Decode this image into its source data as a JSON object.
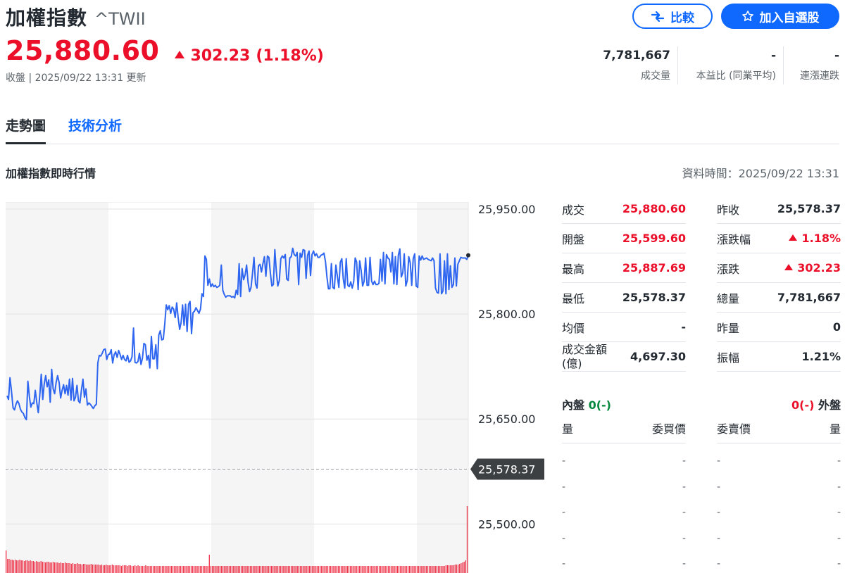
{
  "header": {
    "title": "加權指數",
    "ticker": "^TWII",
    "compare_label": "比較",
    "watchlist_label": "加入自選股",
    "price": "25,880.60",
    "change": "302.23",
    "change_pct": "(1.18%)",
    "status": "收盤 | 2025/09/22 13:31 更新"
  },
  "top_stats": [
    {
      "value": "7,781,667",
      "label": "成交量"
    },
    {
      "value": "-",
      "label": "本益比 (同業平均)"
    },
    {
      "value": "-",
      "label": "連漲連跌"
    }
  ],
  "tabs": [
    {
      "label": "走勢圖",
      "active": true
    },
    {
      "label": "技術分析",
      "active": false
    }
  ],
  "section": {
    "title": "加權指數即時行情",
    "data_time": "資料時間：2025/09/22 13:31"
  },
  "chart_data": {
    "type": "line",
    "y_ticks": [
      "25,950.00",
      "25,800.00",
      "25,650.00",
      "25,500.00"
    ],
    "y_tick_values": [
      25950,
      25800,
      25650,
      25500
    ],
    "prev_close": 25578.37,
    "prev_close_label": "25,578.37",
    "ylim": [
      25430,
      25960
    ],
    "series": [
      {
        "values": [
          25683,
          25678,
          25709,
          25690,
          25666,
          25663,
          25671,
          25676,
          25672,
          25664,
          25660,
          25658,
          25652,
          25649,
          25704,
          25682,
          25667,
          25673,
          25672,
          25691,
          25673,
          25659,
          25684,
          25714,
          25678,
          25700,
          25712,
          25696,
          25706,
          25674,
          25721,
          25693,
          25686,
          25702,
          25712,
          25702,
          25680,
          25691,
          25699,
          25686,
          25698,
          25684,
          25707,
          25677,
          25708,
          25676,
          25681,
          25698,
          25676,
          25673,
          25691,
          25707,
          25681,
          25693,
          25670,
          25673,
          25671,
          25668,
          25665,
          25669,
          25671,
          25730,
          25741,
          25740,
          25744,
          25749,
          25750,
          25735,
          25742,
          25743,
          25749,
          25730,
          25742,
          25746,
          25738,
          25748,
          25742,
          25735,
          25741,
          25735,
          25733,
          25741,
          25731,
          25733,
          25739,
          25780,
          25731,
          25730,
          25732,
          25744,
          25728,
          25737,
          25758,
          25756,
          25734,
          25741,
          25723,
          25768,
          25736,
          25736,
          25756,
          25722,
          25770,
          25776,
          25763,
          25764,
          25786,
          25813,
          25806,
          25812,
          25801,
          25810,
          25807,
          25795,
          25816,
          25795,
          25778,
          25788,
          25813,
          25784,
          25814,
          25775,
          25814,
          25818,
          25772,
          25802,
          25804,
          25809,
          25805,
          25801,
          25807,
          25829,
          25825,
          25883,
          25878,
          25841,
          25850,
          25839,
          25843,
          25839,
          25841,
          25838,
          25839,
          25841,
          25870,
          25834,
          25828,
          25824,
          25826,
          25826,
          25826,
          25824,
          25825,
          25823,
          25834,
          25828,
          25872,
          25825,
          25865,
          25849,
          25856,
          25870,
          25845,
          25832,
          25838,
          25858,
          25881,
          25843,
          25837,
          25869,
          25871,
          25860,
          25872,
          25882,
          25854,
          25883,
          25881,
          25858,
          25840,
          25842,
          25892,
          25861,
          25840,
          25848,
          25879,
          25883,
          25880,
          25885,
          25850,
          25848,
          25880,
          25882,
          25894,
          25885,
          25883,
          25888,
          25842,
          25887,
          25881,
          25892,
          25891,
          25851,
          25884,
          25890,
          25855,
          25885,
          25890,
          25883,
          25886,
          25881,
          25881,
          25884,
          25885,
          25887,
          25875,
          25853,
          25836,
          25836,
          25872,
          25838,
          25836,
          25870,
          25854,
          25838,
          25874,
          25879,
          25850,
          25837,
          25879,
          25841,
          25839,
          25846,
          25837,
          25846,
          25880,
          25874,
          25835,
          25876,
          25862,
          25840,
          25847,
          25880,
          25841,
          25841,
          25881,
          25847,
          25842,
          25847,
          25842,
          25842,
          25844,
          25878,
          25847,
          25888,
          25843,
          25885,
          25880,
          25878,
          25860,
          25888,
          25843,
          25882,
          25842,
          25884,
          25893,
          25853,
          25859,
          25886,
          25840,
          25848,
          25882,
          25873,
          25841,
          25879,
          25886,
          25840,
          25838,
          25883,
          25877,
          25883,
          25878,
          25879,
          25880,
          25878,
          25877,
          25876,
          25880,
          25876,
          25837,
          25831,
          25830,
          25886,
          25829,
          25833,
          25876,
          25829,
          25886,
          25835,
          25869,
          25838,
          25842,
          25880,
          25840,
          25871,
          25876,
          25881,
          25880,
          25880,
          25880,
          25878,
          25884
        ]
      }
    ],
    "volume": [
      32,
      20,
      20,
      19,
      19,
      18,
      19,
      18,
      18,
      19,
      18,
      18,
      17,
      18,
      18,
      17,
      18,
      17,
      17,
      16,
      17,
      16,
      16,
      17,
      16,
      16,
      15,
      16,
      16,
      15,
      15,
      16,
      15,
      15,
      15,
      14,
      15,
      14,
      14,
      15,
      14,
      14,
      14,
      13,
      14,
      13,
      13,
      14,
      13,
      13,
      12,
      13,
      13,
      12,
      12,
      12,
      13,
      12,
      12,
      12,
      12,
      12,
      11,
      12,
      11,
      11,
      12,
      11,
      11,
      11,
      12,
      11,
      11,
      11,
      11,
      11,
      10,
      11,
      11,
      11,
      10,
      11,
      11,
      10,
      10,
      11,
      10,
      11,
      10,
      10,
      10,
      10,
      11,
      10,
      10,
      10,
      10,
      10,
      10,
      10,
      10,
      10,
      10,
      10,
      10,
      10,
      10,
      10,
      10,
      10,
      10,
      10,
      10,
      10,
      10,
      10,
      10,
      10,
      10,
      10,
      10,
      10,
      10,
      10,
      10,
      10,
      10,
      10,
      10,
      10,
      10,
      10,
      10,
      10,
      26,
      10,
      10,
      10,
      10,
      10,
      10,
      10,
      10,
      10,
      10,
      10,
      10,
      10,
      10,
      10,
      10,
      10,
      10,
      10,
      10,
      10,
      10,
      10,
      10,
      10,
      10,
      10,
      10,
      10,
      10,
      10,
      10,
      10,
      10,
      10,
      10,
      10,
      10,
      10,
      10,
      10,
      10,
      10,
      10,
      10,
      10,
      10,
      10,
      10,
      10,
      10,
      10,
      10,
      10,
      10,
      10,
      10,
      10,
      10,
      10,
      10,
      10,
      10,
      10,
      10,
      10,
      10,
      10,
      10,
      10,
      10,
      10,
      10,
      10,
      10,
      10,
      10,
      10,
      10,
      10,
      10,
      10,
      10,
      10,
      10,
      10,
      10,
      10,
      10,
      10,
      10,
      10,
      10,
      10,
      10,
      10,
      10,
      10,
      10,
      10,
      10,
      10,
      10,
      10,
      10,
      10,
      10,
      10,
      10,
      10,
      10,
      10,
      10,
      10,
      10,
      10,
      10,
      10,
      10,
      10,
      10,
      10,
      10,
      10,
      10,
      10,
      10,
      10,
      10,
      10,
      10,
      10,
      10,
      10,
      10,
      10,
      10,
      10,
      10,
      10,
      10,
      10,
      10,
      10,
      10,
      10,
      10,
      10,
      10,
      10,
      10,
      10,
      10,
      10,
      10,
      11,
      11,
      11,
      11,
      11,
      11,
      12,
      12,
      12,
      13,
      14,
      15,
      16,
      18,
      95
    ]
  },
  "quote": [
    [
      {
        "label": "成交",
        "value": "25,880.60",
        "up": true
      },
      {
        "label": "昨收",
        "value": "25,578.37"
      }
    ],
    [
      {
        "label": "開盤",
        "value": "25,599.60",
        "up": true
      },
      {
        "label": "漲跌幅",
        "value": "1.18%",
        "up": true,
        "arrow": true
      }
    ],
    [
      {
        "label": "最高",
        "value": "25,887.69",
        "up": true
      },
      {
        "label": "漲跌",
        "value": "302.23",
        "up": true,
        "arrow": true
      }
    ],
    [
      {
        "label": "最低",
        "value": "25,578.37"
      },
      {
        "label": "總量",
        "value": "7,781,667"
      }
    ],
    [
      {
        "label": "均價",
        "value": "-"
      },
      {
        "label": "昨量",
        "value": "0"
      }
    ],
    [
      {
        "label": "成交金額\n(億)",
        "value": "4,697.30"
      },
      {
        "label": "振幅",
        "value": "1.21%"
      }
    ]
  ],
  "inner_outer": {
    "inner_label": "內盤",
    "inner_value": "0(-)",
    "outer_value": "0(-)",
    "outer_label": "外盤"
  },
  "order_book": {
    "headers": [
      "量",
      "委買價",
      "委賣價",
      "量"
    ],
    "rows": [
      [
        "-",
        "-",
        "-",
        "-"
      ],
      [
        "-",
        "-",
        "-",
        "-"
      ],
      [
        "-",
        "-",
        "-",
        "-"
      ],
      [
        "-",
        "-",
        "-",
        "-"
      ],
      [
        "-",
        "-",
        "-",
        "-"
      ]
    ]
  },
  "colors": {
    "up": "#eb0f29",
    "down": "#00873c",
    "accent": "#0f69ff",
    "line": "#2f66f0"
  }
}
